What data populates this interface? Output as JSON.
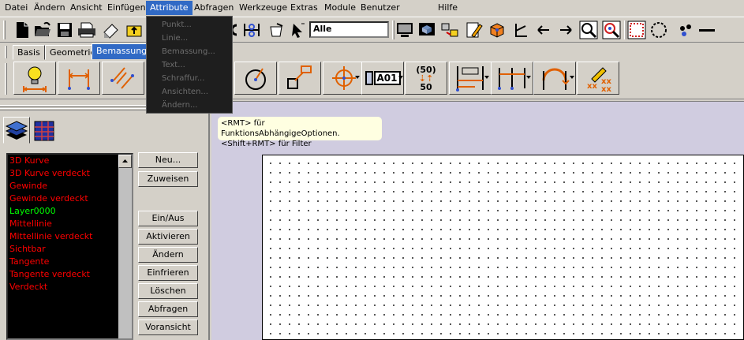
{
  "menubar": {
    "items": [
      "Datei",
      "Ändern",
      "Ansicht",
      "Einfügen",
      "Attribute",
      "Abfragen",
      "Werkzeuge",
      "Extras",
      "Module",
      "Benutzer",
      "Hilfe"
    ],
    "active": "Attribute"
  },
  "attribute_menu": {
    "items": [
      "Punkt...",
      "Linie...",
      "Bemassung...",
      "Text...",
      "Schraffur...",
      "Ansichten...",
      "Ändern..."
    ]
  },
  "toolbar1": {
    "layer_filter_value": "Alle",
    "icons": [
      "new-file-icon",
      "open-folder-icon",
      "save-icon",
      "print-icon",
      "eraser-icon",
      "folder-up-icon",
      "undo-icon",
      "snap-icon",
      "filter-icon",
      "select-arrow-icon",
      "monitor-icon",
      "3d-view-icon",
      "transfer-icon",
      "edit-pencil-icon",
      "3d-cube-icon",
      "angle-icon",
      "arrow-left-icon",
      "arrow-right-icon",
      "zoom-window-icon",
      "zoom-target-icon",
      "select-rect-icon",
      "select-circle-icon",
      "points-icon",
      "line-icon"
    ]
  },
  "tabs": {
    "items": [
      "Basis",
      "Geometrie",
      "Bemassung"
    ],
    "active": "Bemassung"
  },
  "toolbar2": {
    "dim_value_top": "(50)",
    "dim_value_bottom": "50",
    "text_box_label": "A01",
    "icons": [
      "bulb-dim-icon",
      "linear-dim-icon",
      "aligned-dim-icon",
      "angle-dim-icon",
      "radius-dim-icon",
      "leader-dim-icon",
      "center-mark-icon",
      "text-box-icon",
      "tolerance-dim-icon",
      "baseline-dim-icon",
      "chain-dim-icon",
      "arc-dim-icon",
      "erase-dim-icon"
    ]
  },
  "layers": {
    "items": [
      {
        "name": "3D Kurve",
        "color": "#ff0000"
      },
      {
        "name": "3D Kurve verdeckt",
        "color": "#ff0000"
      },
      {
        "name": "Gewinde",
        "color": "#ff0000"
      },
      {
        "name": "Gewinde verdeckt",
        "color": "#ff0000"
      },
      {
        "name": "Layer0000",
        "color": "#00ff00"
      },
      {
        "name": "Mittellinie",
        "color": "#ff0000"
      },
      {
        "name": "Mittellinie verdeckt",
        "color": "#ff0000"
      },
      {
        "name": "Sichtbar",
        "color": "#ff0000"
      },
      {
        "name": "Tangente",
        "color": "#ff0000"
      },
      {
        "name": "Tangente verdeckt",
        "color": "#ff0000"
      },
      {
        "name": "Verdeckt",
        "color": "#ff0000"
      }
    ]
  },
  "layer_buttons": [
    "Neu...",
    "Zuweisen",
    "Ein/Aus",
    "Aktivieren",
    "Ändern",
    "Einfrieren",
    "Löschen",
    "Abfragen",
    "Voransicht"
  ],
  "tooltip": {
    "line1": "<RMT> für FunktionsAbhängigeOptionen.",
    "line2": "<Shift+RMT> für Filter"
  }
}
